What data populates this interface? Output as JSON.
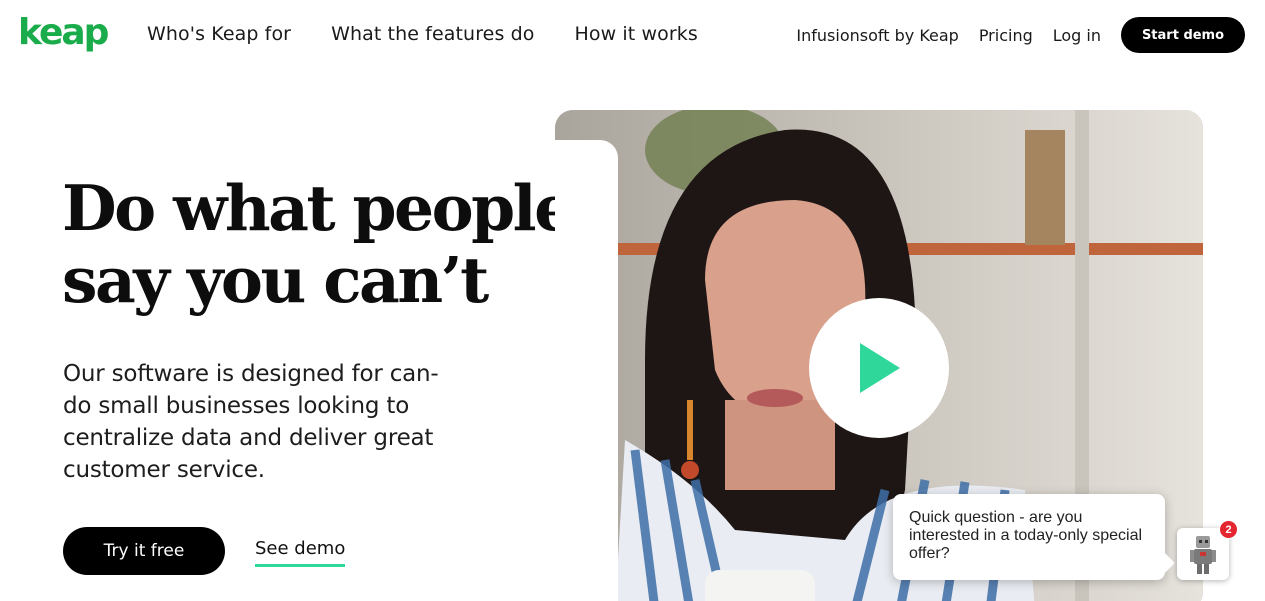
{
  "header": {
    "logo_text": "keap",
    "nav_left": [
      "Who's Keap for",
      "What the features do",
      "How it works"
    ],
    "nav_right": [
      "Infusionsoft by Keap",
      "Pricing",
      "Log in"
    ],
    "cta": "Start demo"
  },
  "hero": {
    "headline_line1": "Do what people",
    "headline_line2": "say you can’t",
    "subtext": "Our software is designed for can-do small businesses looking to centralize data and deliver great customer service.",
    "primary_button": "Try it free",
    "secondary_link": "See demo"
  },
  "video": {
    "play_icon": "play-icon"
  },
  "chat": {
    "message": "Quick question - are you interested in a today-only special offer?",
    "badge_count": "2"
  },
  "colors": {
    "brand_green": "#1aac4b",
    "accent_mint": "#2fd79b",
    "black": "#000000",
    "badge_red": "#e3262f"
  }
}
